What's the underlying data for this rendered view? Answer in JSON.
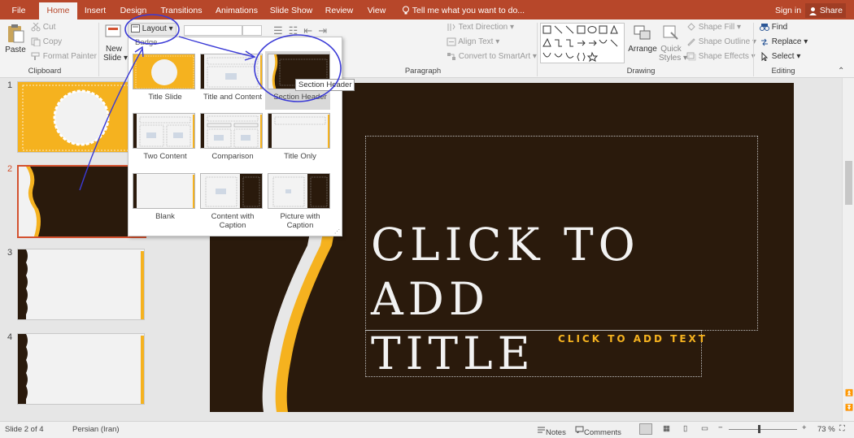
{
  "tabs": [
    "File",
    "Home",
    "Insert",
    "Design",
    "Transitions",
    "Animations",
    "Slide Show",
    "Review",
    "View"
  ],
  "active_tab": "Home",
  "tell_me": "Tell me what you want to do...",
  "sign_in": "Sign in",
  "share": "Share",
  "clipboard": {
    "paste": "Paste",
    "cut": "Cut",
    "copy": "Copy",
    "format_painter": "Format Painter",
    "group_label": "Clipboard"
  },
  "slides": {
    "new_slide_line1": "New",
    "new_slide_line2": "Slide",
    "layout": "Layout",
    "reset_partial": "Reset",
    "section_partial": "Section"
  },
  "paragraph": {
    "text_direction": "Text Direction",
    "align_text": "Align Text",
    "convert_smartart": "Convert to SmartArt",
    "group_label": "Paragraph"
  },
  "drawing": {
    "arrange": "Arrange",
    "quick_styles_line1": "Quick",
    "quick_styles_line2": "Styles",
    "shape_fill": "Shape Fill",
    "shape_outline": "Shape Outline",
    "shape_effects": "Shape Effects",
    "group_label": "Drawing"
  },
  "editing": {
    "find": "Find",
    "replace": "Replace",
    "select": "Select",
    "group_label": "Editing"
  },
  "layout_gallery": {
    "header_partial": "Badge",
    "items": [
      {
        "label": "Title Slide"
      },
      {
        "label": "Title and Content"
      },
      {
        "label": "Section Header"
      },
      {
        "label": "Two Content"
      },
      {
        "label": "Comparison"
      },
      {
        "label": "Title Only"
      },
      {
        "label": "Blank"
      },
      {
        "label_line1": "Content with",
        "label_line2": "Caption"
      },
      {
        "label_line1": "Picture with",
        "label_line2": "Caption"
      }
    ],
    "tooltip": "Section Header"
  },
  "thumbnails": [
    "1",
    "2",
    "3",
    "4"
  ],
  "selected_slide": "2",
  "slide": {
    "title_line1": "CLICK TO ADD",
    "title_line2": "TITLE",
    "subtitle": "CLICK TO ADD TEXT"
  },
  "status": {
    "slide_info": "Slide 2 of 4",
    "language": "Persian (Iran)",
    "notes": "Notes",
    "comments": "Comments",
    "zoom_minus": "−",
    "zoom_plus": "+",
    "zoom": "73 %"
  },
  "colors": {
    "accent": "#b7472a",
    "slide_bg": "#2a1a0c",
    "slide_accent": "#f5b21f",
    "annotation": "#3a3ad6"
  }
}
